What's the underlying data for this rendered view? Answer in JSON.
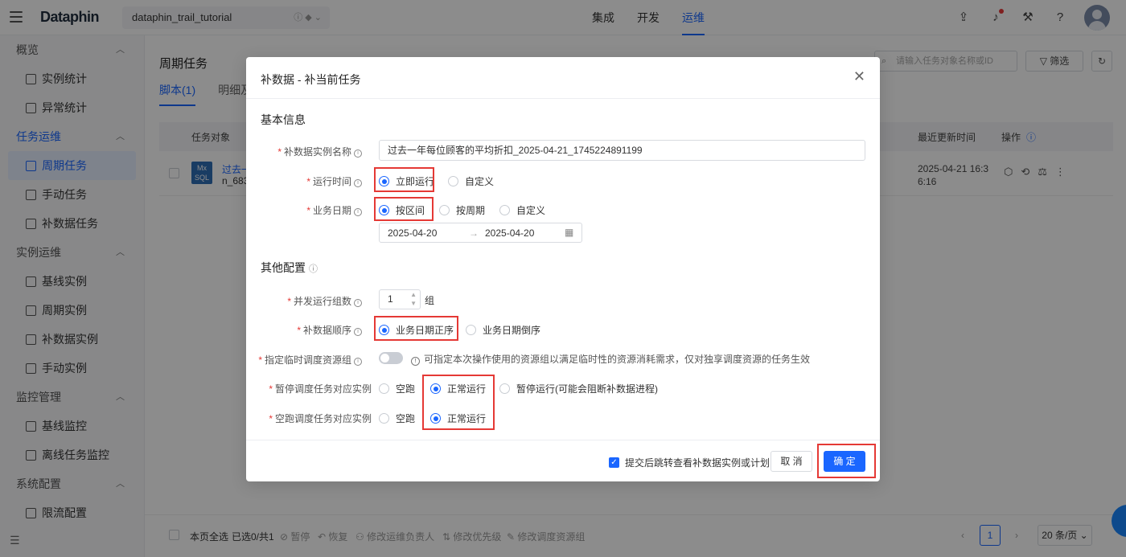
{
  "app": {
    "logo": "Dataphin",
    "project": "dataphin_trail_tutorial",
    "nav_tabs": [
      "集成",
      "开发",
      "运维"
    ],
    "active_tab": "运维"
  },
  "sidebar": {
    "groups": [
      {
        "label": "概览",
        "items": [
          "实例统计",
          "异常统计"
        ]
      },
      {
        "label": "任务运维",
        "items": [
          "周期任务",
          "手动任务",
          "补数据任务"
        ]
      },
      {
        "label": "实例运维",
        "items": [
          "基线实例",
          "周期实例",
          "补数据实例",
          "手动实例"
        ]
      },
      {
        "label": "监控管理",
        "items": [
          "基线监控",
          "离线任务监控"
        ]
      },
      {
        "label": "系统配置",
        "items": [
          "限流配置"
        ]
      }
    ],
    "active_item": "周期任务"
  },
  "page": {
    "title": "周期任务",
    "subtabs": [
      "脚本(1)",
      "明细及"
    ],
    "search_placeholder": "请输入任务对象名称或ID",
    "filter_label": "筛选",
    "columns": {
      "object": "任务对象",
      "updated": "最近更新时间",
      "ops": "操作"
    },
    "row": {
      "name_line1": "过去一",
      "name_line2": "n_683",
      "date_line1": "2025-04-21 16:3",
      "date_line2": "6:16",
      "type_badge": "Mx SQL"
    },
    "bottom": {
      "select_all": "本页全选",
      "selected": "已选0/共1",
      "actions": [
        "暂停",
        "恢复",
        "修改运维负责人",
        "修改优先级",
        "修改调度资源组"
      ],
      "current_page": "1",
      "page_size": "20 条/页"
    }
  },
  "dialog": {
    "title": "补数据 - 补当前任务",
    "basic_section": "基本信息",
    "other_section": "其他配置",
    "labels": {
      "instance_name": "补数据实例名称",
      "run_time": "运行时间",
      "biz_date": "业务日期",
      "concurrency": "并发运行组数",
      "order": "补数据顺序",
      "resource_group": "指定临时调度资源组",
      "paused_instance": "暂停调度任务对应实例",
      "dry_instance": "空跑调度任务对应实例"
    },
    "instance_name_value": "过去一年每位顾客的平均折扣_2025-04-21_1745224891199",
    "run_time_options": [
      "立即运行",
      "自定义"
    ],
    "biz_date_options": [
      "按区间",
      "按周期",
      "自定义"
    ],
    "date_start": "2025-04-20",
    "date_arrow": "→",
    "date_end": "2025-04-20",
    "concurrency_value": "1",
    "concurrency_unit": "组",
    "order_options": [
      "业务日期正序",
      "业务日期倒序"
    ],
    "resource_group_hint": "可指定本次操作使用的资源组以满足临时性的资源消耗需求，仅对独享调度资源的任务生效",
    "paused_options": [
      "空跑",
      "正常运行",
      "暂停运行(可能会阻断补数据进程)"
    ],
    "dry_options": [
      "空跑",
      "正常运行"
    ],
    "footer_checkbox": "提交后跳转查看补数据实例或计划",
    "cancel": "取 消",
    "confirm": "确 定"
  }
}
